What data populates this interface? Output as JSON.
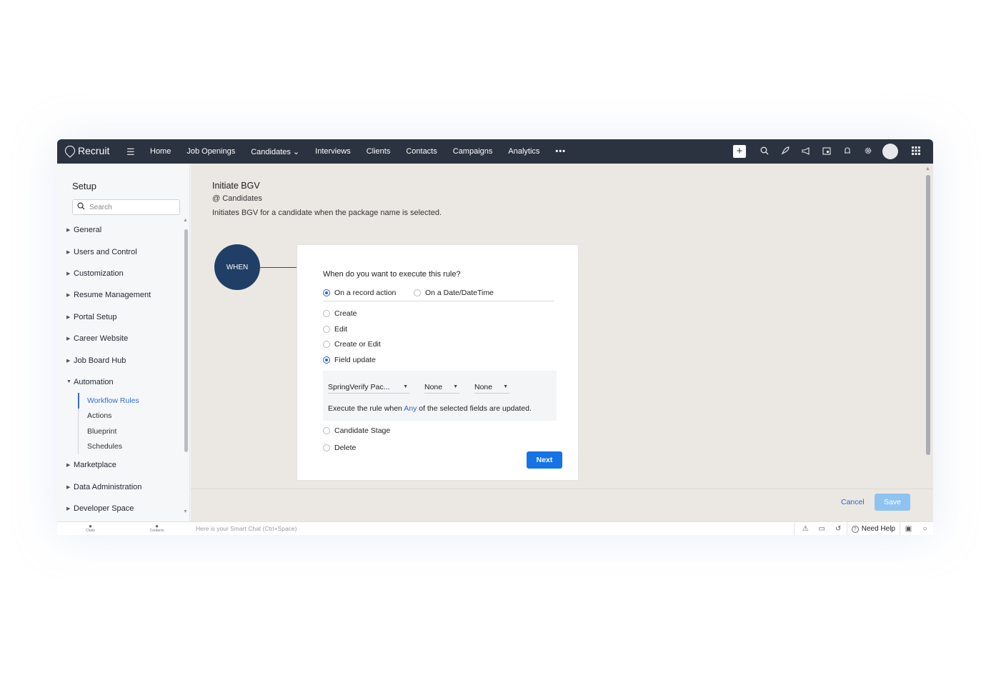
{
  "app": {
    "brand": "Recruit"
  },
  "nav": {
    "items": [
      "Home",
      "Job Openings",
      "Candidates",
      "Interviews",
      "Clients",
      "Contacts",
      "Campaigns",
      "Analytics"
    ],
    "candidates_chevron": "⌄",
    "more": "•••"
  },
  "top_icons": [
    "plus-icon",
    "search-icon",
    "rocket-icon",
    "megaphone-icon",
    "calendar-icon",
    "bell-icon",
    "gear-icon",
    "avatar",
    "apps-grid-icon"
  ],
  "sidebar": {
    "title": "Setup",
    "search_placeholder": "Search",
    "items": [
      "General",
      "Users and Control",
      "Customization",
      "Resume Management",
      "Portal Setup",
      "Career Website",
      "Job Board Hub",
      "Automation"
    ],
    "automation_sub": [
      "Workflow Rules",
      "Actions",
      "Blueprint",
      "Schedules"
    ],
    "items_after": [
      "Marketplace",
      "Data Administration",
      "Developer Space"
    ]
  },
  "rule": {
    "title": "Initiate BGV",
    "module": "@ Candidates",
    "description": "Initiates BGV for a candidate when the package name is selected."
  },
  "when": {
    "label": "WHEN",
    "question": "When do you want to execute this rule?",
    "trigger_options": [
      "On a record action",
      "On a Date/DateTime"
    ],
    "selected_trigger": "On a record action",
    "actions": [
      "Create",
      "Edit",
      "Create or Edit",
      "Field update",
      "Candidate Stage",
      "Delete"
    ],
    "selected_action": "Field update",
    "field_selects": [
      "SpringVerify Pac...",
      "None",
      "None"
    ],
    "execute_prefix": "Execute the rule when ",
    "execute_any": "Any",
    "execute_suffix": " of the selected fields are updated.",
    "next_label": "Next"
  },
  "footer": {
    "cancel_label": "Cancel",
    "save_label": "Save"
  },
  "bottombar": {
    "tabs": [
      "Chats",
      "Contacts"
    ],
    "smart_chat_placeholder": "Here is your Smart Chat (Ctrl+Space)",
    "need_help": "Need Help"
  }
}
